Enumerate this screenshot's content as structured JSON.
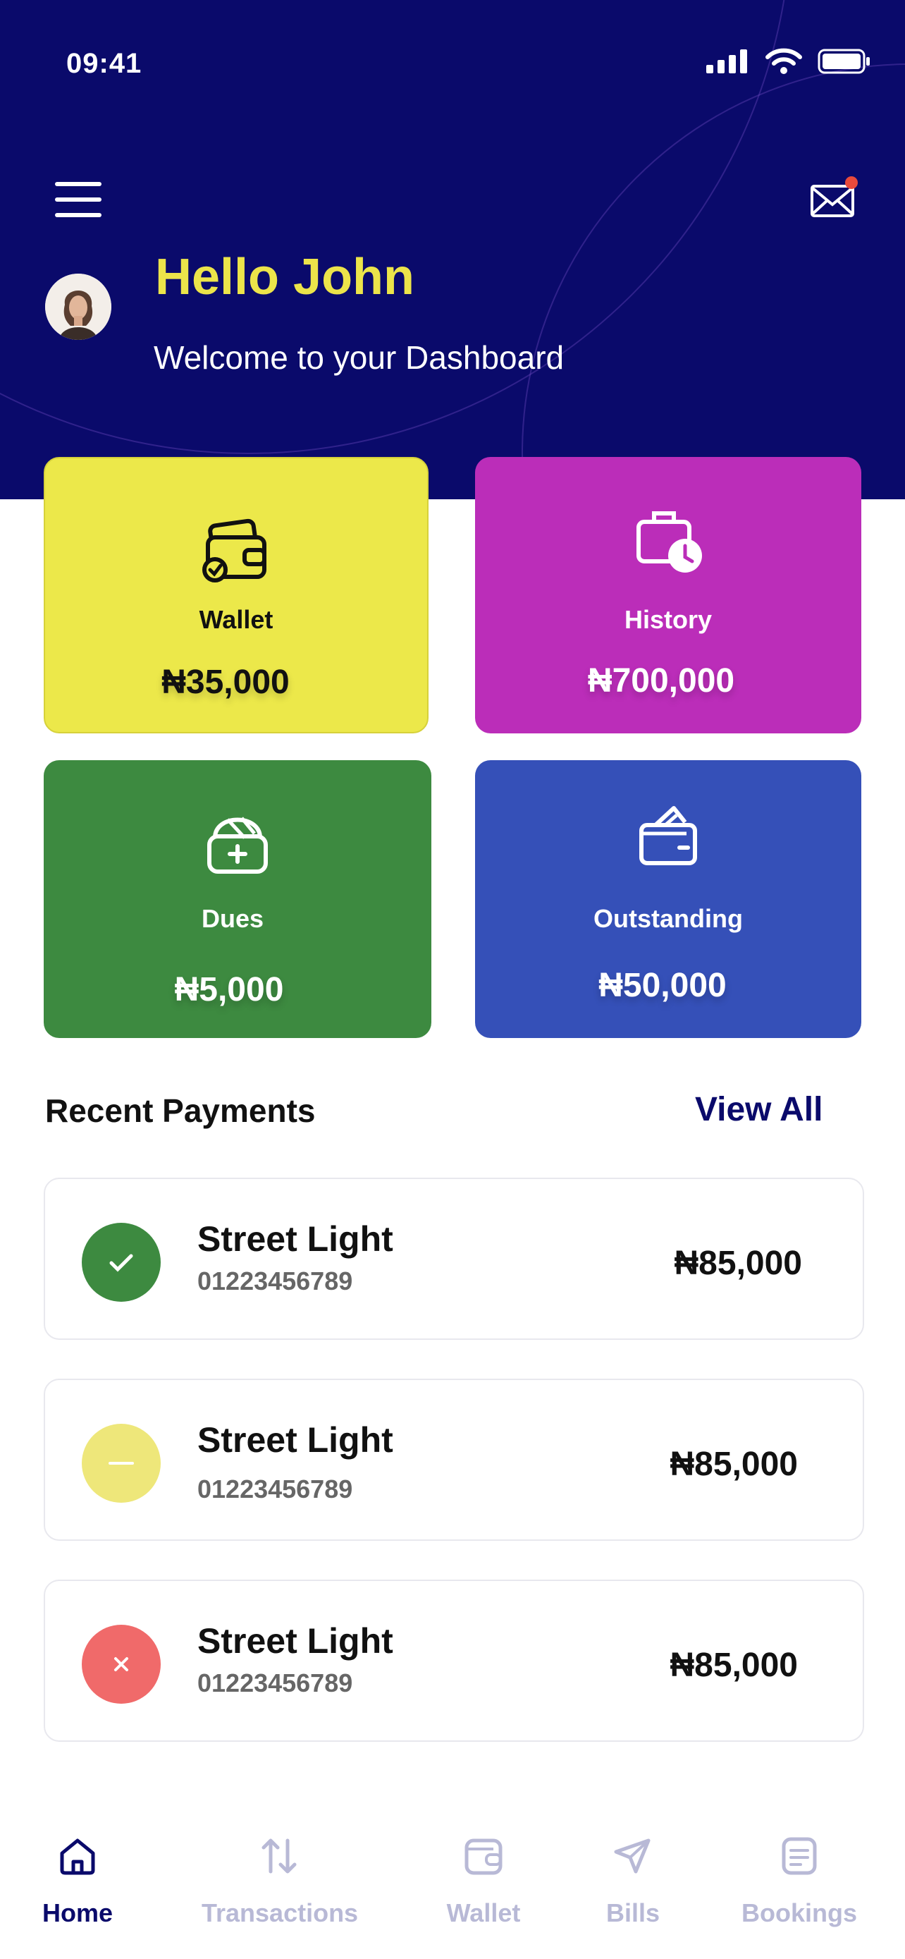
{
  "status_bar": {
    "time": "09:41"
  },
  "header": {
    "greeting": "Hello John",
    "welcome": "Welcome to your Dashboard"
  },
  "cards": [
    {
      "label": "Wallet",
      "amount": "₦35,000",
      "color": "#ece84a",
      "text_color": "#111111",
      "icon": "wallet-check-icon"
    },
    {
      "label": "History",
      "amount": "₦700,000",
      "color": "#bb2db9",
      "text_color": "#ffffff",
      "icon": "briefcase-clock-icon"
    },
    {
      "label": "Dues",
      "amount": "₦5,000",
      "color": "#3d8a40",
      "text_color": "#ffffff",
      "icon": "wallet-plus-icon"
    },
    {
      "label": "Outstanding",
      "amount": "₦50,000",
      "color": "#3550b8",
      "text_color": "#ffffff",
      "icon": "wallet-icon"
    }
  ],
  "recent": {
    "title": "Recent Payments",
    "view_all": "View All",
    "items": [
      {
        "name": "Street Light",
        "account": "01223456789",
        "amount": "₦85,000",
        "status": "success",
        "status_color": "#3d8a40",
        "glyph": "✓"
      },
      {
        "name": "Street Light",
        "account": "01223456789",
        "amount": "₦85,000",
        "status": "pending",
        "status_color": "#eee77a",
        "glyph": "—"
      },
      {
        "name": "Street Light",
        "account": "01223456789",
        "amount": "₦85,000",
        "status": "failed",
        "status_color": "#f06a6a",
        "glyph": "✕"
      }
    ]
  },
  "nav": {
    "items": [
      {
        "label": "Home",
        "icon": "home-icon",
        "active": true
      },
      {
        "label": "Transactions",
        "icon": "arrows-up-down-icon",
        "active": false
      },
      {
        "label": "Wallet",
        "icon": "wallet-icon",
        "active": false
      },
      {
        "label": "Bills",
        "icon": "send-icon",
        "active": false
      },
      {
        "label": "Bookings",
        "icon": "document-icon",
        "active": false
      }
    ],
    "active_color": "#0a0a6b",
    "inactive_color": "#b8b9d6"
  },
  "colors": {
    "header_bg": "#0a0a6b",
    "accent_yellow": "#ece44a",
    "notification_dot": "#e84a3c"
  }
}
